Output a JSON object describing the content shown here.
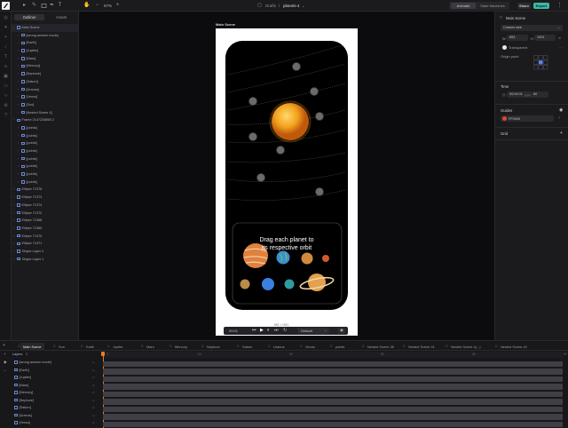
{
  "toolbar": {
    "breadcrumb_drafts": "Drafts",
    "breadcrumb_sep": "/",
    "file_name": "planets-4",
    "zoom": "57%",
    "animate_label": "Animate",
    "state_machines_label": "State Machines",
    "share_label": "Share",
    "export_label": "Export"
  },
  "left_panel": {
    "tabs": [
      "Outliner",
      "Assets"
    ],
    "items": [
      {
        "label": "Main Scene",
        "indent": 0,
        "selected": true
      },
      {
        "label": "[wrong answer mode]",
        "indent": 1
      },
      {
        "label": "[Earth]",
        "indent": 1
      },
      {
        "label": "[Jupiter]",
        "indent": 1
      },
      {
        "label": "[Mars]",
        "indent": 1
      },
      {
        "label": "[Mercury]",
        "indent": 1
      },
      {
        "label": "[Neptune]",
        "indent": 1
      },
      {
        "label": "[Saturn]",
        "indent": 1
      },
      {
        "label": "[Uranus]",
        "indent": 1
      },
      {
        "label": "[Venus]",
        "indent": 1
      },
      {
        "label": "[Sun]",
        "indent": 1
      },
      {
        "label": "[Nested Scene 4]",
        "indent": 1
      },
      {
        "label": "Frame 2147226858 2",
        "indent": 0
      },
      {
        "label": "[points]",
        "indent": 1
      },
      {
        "label": "[points]",
        "indent": 1
      },
      {
        "label": "[points]",
        "indent": 1
      },
      {
        "label": "[points]",
        "indent": 1
      },
      {
        "label": "[points]",
        "indent": 1
      },
      {
        "label": "[points]",
        "indent": 1
      },
      {
        "label": "[points]",
        "indent": 1
      },
      {
        "label": "[points]",
        "indent": 1
      },
      {
        "label": "Ellipse 71376",
        "indent": 0
      },
      {
        "label": "Ellipse 71373",
        "indent": 0
      },
      {
        "label": "Ellipse 71374",
        "indent": 0
      },
      {
        "label": "Ellipse 71372",
        "indent": 0
      },
      {
        "label": "Ellipse 71368",
        "indent": 0
      },
      {
        "label": "Ellipse 71369",
        "indent": 0
      },
      {
        "label": "Ellipse 71370",
        "indent": 0
      },
      {
        "label": "Ellipse 71371",
        "indent": 0
      },
      {
        "label": "Shape Layer 2",
        "indent": 0
      },
      {
        "label": "Shape Layer 1",
        "indent": 0
      }
    ]
  },
  "canvas": {
    "artboard_label": "Main Scene",
    "prompt_line1": "Drag each planet to",
    "prompt_line2": "its respective orbit",
    "size_readout": "853 × 1931",
    "playback": {
      "time": "00:01",
      "mode": "Default"
    }
  },
  "right_panel": {
    "title": "Main Scene",
    "size_preset": "Custom size",
    "width": "853",
    "height": "1931",
    "transparent_label": "Transparent",
    "origin_label": "Origin point",
    "time_label": "Time",
    "duration": "00:04:01",
    "fps_label": "FPS",
    "fps": "60",
    "guides_label": "Guides",
    "guide_color": "FF0000",
    "grid_label": "Grid"
  },
  "timeline": {
    "tabs": [
      "Main Scene",
      "Sun",
      "Earth",
      "Jupiter",
      "Mars",
      "Mercury",
      "Neptune",
      "Saturn",
      "Uranus",
      "Venus",
      "points",
      "Nested Scene 38",
      "Nested Scene 41",
      "Nested Scene 4(...)",
      "Nested Scene 42"
    ],
    "layers_label": "Layers",
    "rows": [
      "[wrong answer mode]",
      "[Earth]",
      "[Jupiter]",
      "[Mars]",
      "[Mercury]",
      "[Neptune]",
      "[Saturn]",
      "[Uranus]",
      "[Venus]"
    ],
    "ruler": [
      "0",
      "10",
      "20",
      "30",
      "40",
      "50"
    ]
  },
  "colors": {
    "accent": "#3fb6a8",
    "selection": "#5b7ff2",
    "guide": "#e0462f"
  }
}
